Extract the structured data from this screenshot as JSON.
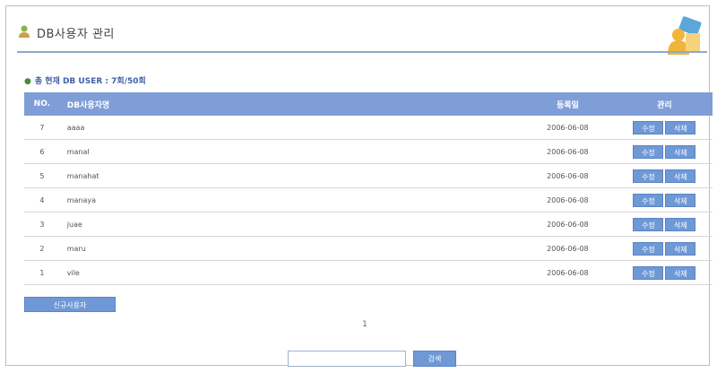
{
  "header": {
    "title": "DB사용자 관리",
    "title_icon": "user-icon",
    "decoration_icon": "user-card-illustration"
  },
  "summary": {
    "text": "총 현재 DB USER : 7회/50회"
  },
  "table": {
    "headers": {
      "no": "NO.",
      "name": "DB사용자명",
      "date": "등록일",
      "actions": "관리"
    },
    "edit_label": "수정",
    "delete_label": "삭제",
    "rows": [
      {
        "no": "7",
        "name": "aaaa",
        "date": "2006-06-08"
      },
      {
        "no": "6",
        "name": "manal",
        "date": "2006-06-08"
      },
      {
        "no": "5",
        "name": "manahat",
        "date": "2006-06-08"
      },
      {
        "no": "4",
        "name": "manaya",
        "date": "2006-06-08"
      },
      {
        "no": "3",
        "name": "juae",
        "date": "2006-06-08"
      },
      {
        "no": "2",
        "name": "maru",
        "date": "2006-06-08"
      },
      {
        "no": "1",
        "name": "vile",
        "date": "2006-06-08"
      }
    ]
  },
  "new_user_button": "신규사용자",
  "pagination": {
    "current": "1"
  },
  "search": {
    "value": "",
    "button_label": "검색"
  },
  "colors": {
    "accent": "#7f9ed8",
    "button": "#6f99d6",
    "summary_text": "#3f62a8"
  }
}
